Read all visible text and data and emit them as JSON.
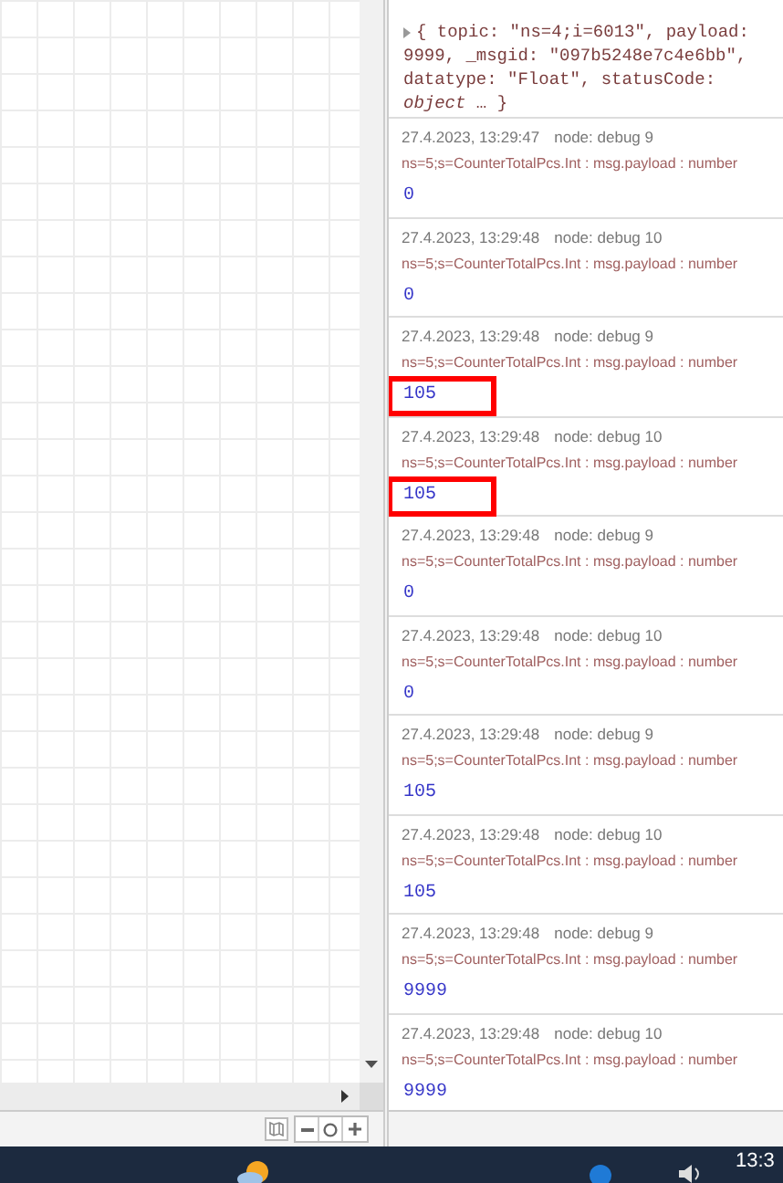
{
  "debug_panel": {
    "top_message": {
      "value": "{ topic: \"ns=4;i=6013\", payload: 9999, _msgid: \"097b5248e7c4e6bb\", datatype: \"Float\", statusCode: *object* … }"
    },
    "messages": [
      {
        "timestamp": "27.4.2023, 13:29:47",
        "node": "node: debug 9",
        "topic": "ns=5;s=CounterTotalPcs.Int : msg.payload : number",
        "value": "0",
        "highlighted": false
      },
      {
        "timestamp": "27.4.2023, 13:29:48",
        "node": "node: debug 10",
        "topic": "ns=5;s=CounterTotalPcs.Int : msg.payload : number",
        "value": "0",
        "highlighted": false
      },
      {
        "timestamp": "27.4.2023, 13:29:48",
        "node": "node: debug 9",
        "topic": "ns=5;s=CounterTotalPcs.Int : msg.payload : number",
        "value": "105",
        "highlighted": true
      },
      {
        "timestamp": "27.4.2023, 13:29:48",
        "node": "node: debug 10",
        "topic": "ns=5;s=CounterTotalPcs.Int : msg.payload : number",
        "value": "105",
        "highlighted": true
      },
      {
        "timestamp": "27.4.2023, 13:29:48",
        "node": "node: debug 9",
        "topic": "ns=5;s=CounterTotalPcs.Int : msg.payload : number",
        "value": "0",
        "highlighted": false
      },
      {
        "timestamp": "27.4.2023, 13:29:48",
        "node": "node: debug 10",
        "topic": "ns=5;s=CounterTotalPcs.Int : msg.payload : number",
        "value": "0",
        "highlighted": false
      },
      {
        "timestamp": "27.4.2023, 13:29:48",
        "node": "node: debug 9",
        "topic": "ns=5;s=CounterTotalPcs.Int : msg.payload : number",
        "value": "105",
        "highlighted": false
      },
      {
        "timestamp": "27.4.2023, 13:29:48",
        "node": "node: debug 10",
        "topic": "ns=5;s=CounterTotalPcs.Int : msg.payload : number",
        "value": "105",
        "highlighted": false
      },
      {
        "timestamp": "27.4.2023, 13:29:48",
        "node": "node: debug 9",
        "topic": "ns=5;s=CounterTotalPcs.Int : msg.payload : number",
        "value": "9999",
        "highlighted": false
      },
      {
        "timestamp": "27.4.2023, 13:29:48",
        "node": "node: debug 10",
        "topic": "ns=5;s=CounterTotalPcs.Int : msg.payload : number",
        "value": "9999",
        "highlighted": false
      }
    ]
  },
  "taskbar": {
    "clock": "13:3"
  }
}
